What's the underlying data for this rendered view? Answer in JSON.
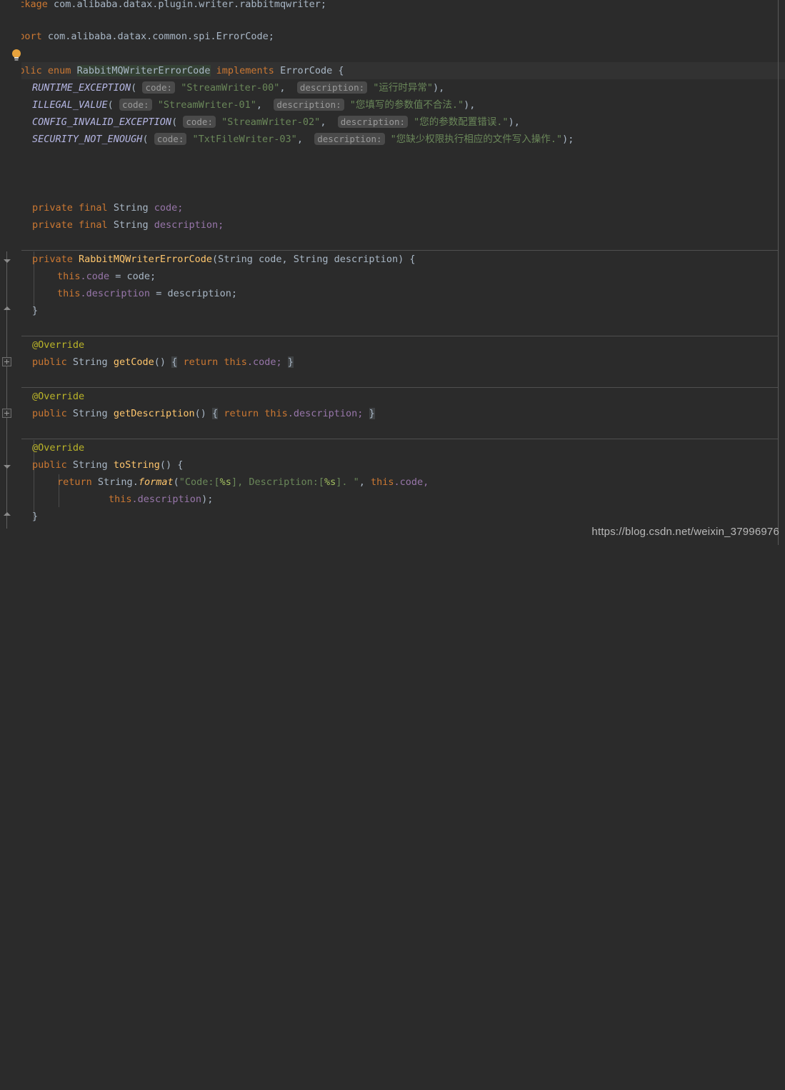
{
  "editor": {
    "theme": "darcula",
    "background": "#2b2b2b",
    "foreground": "#a9b7c6",
    "keyword_color": "#cc7832",
    "string_color": "#6a8759",
    "annotation_color": "#bbb529",
    "field_color": "#9876aa",
    "method_color": "#ffc66d",
    "enum_constant_color": "#b5b6e3",
    "caret_line_color": "#323232",
    "identifier_highlight_color": "#344134"
  },
  "package": {
    "keyword": "package",
    "name": "com.alibaba.datax.plugin.writer.rabbitmqwriter;"
  },
  "import": {
    "keyword": "import",
    "name": "com.alibaba.datax.common.spi.ErrorCode;"
  },
  "class_decl": {
    "modifier": "public",
    "kind": "enum",
    "name": "RabbitMQWriterErrorCode",
    "implements_keyword": "implements",
    "interface": "ErrorCode",
    "open_brace": "{"
  },
  "hints": {
    "code": "code:",
    "description": "description:"
  },
  "enum_constants": [
    {
      "name": "RUNTIME_EXCEPTION",
      "code": "\"StreamWriter-00\"",
      "description": "\"运行时异常\"",
      "terminator": "),"
    },
    {
      "name": "ILLEGAL_VALUE",
      "code": "\"StreamWriter-01\"",
      "description": "\"您填写的参数值不合法.\"",
      "terminator": "),"
    },
    {
      "name": "CONFIG_INVALID_EXCEPTION",
      "code": "\"StreamWriter-02\"",
      "description": "\"您的参数配置错误.\"",
      "terminator": "),"
    },
    {
      "name": "SECURITY_NOT_ENOUGH",
      "code": "\"TxtFileWriter-03\"",
      "description": "\"您缺少权限执行相应的文件写入操作.\"",
      "terminator": ");"
    }
  ],
  "fields": [
    {
      "modifiers": "private final",
      "type": "String",
      "name": "code;"
    },
    {
      "modifiers": "private final",
      "type": "String",
      "name": "description;"
    }
  ],
  "constructor": {
    "modifier": "private",
    "name": "RabbitMQWriterErrorCode",
    "params": "(String code, String description) {",
    "body_line_1_this": "this",
    "body_line_1_field": ".code",
    "body_line_1_rest": " = code;",
    "body_line_2_this": "this",
    "body_line_2_field": ".description",
    "body_line_2_rest": " = description;",
    "close_brace": "}"
  },
  "methods": [
    {
      "annotation": "@Override",
      "modifier": "public",
      "type": "String",
      "name": "getCode",
      "parens": "()",
      "open_brace": "{",
      "return_keyword": "return",
      "return_this": "this",
      "return_field": ".code;",
      "close_brace": "}"
    },
    {
      "annotation": "@Override",
      "modifier": "public",
      "type": "String",
      "name": "getDescription",
      "parens": "()",
      "open_brace": "{",
      "return_keyword": "return",
      "return_this": "this",
      "return_field": ".description;",
      "close_brace": "}"
    }
  ],
  "to_string": {
    "annotation": "@Override",
    "modifier": "public",
    "type": "String",
    "name": "toString",
    "signature_tail": "() {",
    "return_keyword": "return",
    "string_class": "String",
    "dot": ".",
    "format_method": "format",
    "open_paren": "(",
    "fmt_part_1": "\"Code:[",
    "fmt_spec_1": "%s",
    "fmt_part_2": "], Description:[",
    "fmt_spec_2": "%s",
    "fmt_part_3": "]. \"",
    "arg_sep": ", ",
    "arg1_this": "this",
    "arg1_field": ".code,",
    "arg2_this": "this",
    "arg2_field": ".description",
    "arg2_tail": ");",
    "close_brace": "}"
  },
  "class_close_brace": "}",
  "watermark": "https://blog.csdn.net/weixin_37996976",
  "icons": {
    "intention_bulb": "lightbulb-icon"
  }
}
